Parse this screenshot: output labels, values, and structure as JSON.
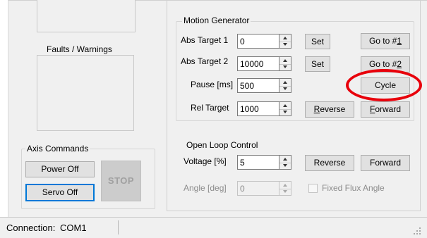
{
  "faults": {
    "title": "Faults / Warnings"
  },
  "axis_commands": {
    "title": "Axis Commands",
    "power_off": "Power Off",
    "servo_off": "Servo Off",
    "stop": "STOP"
  },
  "motion_generator": {
    "title": "Motion Generator",
    "abs_target_1": {
      "label": "Abs Target 1",
      "value": "0",
      "set": "Set",
      "goto_prefix": "Go to #",
      "goto_key": "1"
    },
    "abs_target_2": {
      "label": "Abs Target 2",
      "value": "10000",
      "set": "Set",
      "goto_prefix": "Go to #",
      "goto_key": "2"
    },
    "pause": {
      "label": "Pause [ms]",
      "value": "500",
      "cycle": "Cycle"
    },
    "rel_target": {
      "label": "Rel Target",
      "value": "1000",
      "reverse_key": "R",
      "reverse_rest": "everse",
      "forward_key": "F",
      "forward_rest": "orward"
    }
  },
  "open_loop": {
    "title": "Open Loop Control",
    "voltage": {
      "label": "Voltage [%]",
      "value": "5",
      "reverse": "Reverse",
      "forward": "Forward"
    },
    "angle": {
      "label": "Angle [deg]",
      "value": "0",
      "fixed_flux": "Fixed Flux Angle",
      "fixed_flux_checked": false
    }
  },
  "status_bar": {
    "connection_label": "Connection:",
    "connection_value": "COM1"
  },
  "colors": {
    "annotation_ring": "#e8000b",
    "focus_border": "#0078d7"
  }
}
